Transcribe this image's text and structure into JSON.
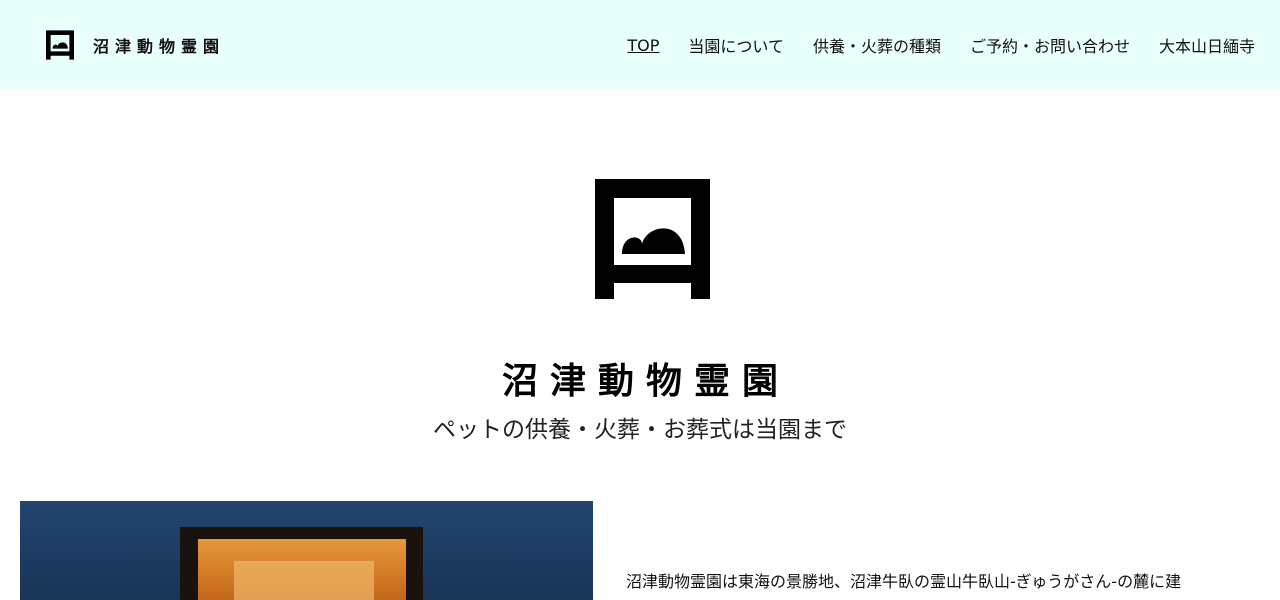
{
  "header": {
    "brand_name": "沼津動物霊園",
    "logo_icon": "mountain-frame-icon",
    "background_color": "#e9fffb"
  },
  "nav": {
    "items": [
      {
        "label": "TOP",
        "active": true
      },
      {
        "label": "当園について",
        "active": false
      },
      {
        "label": "供養・火葬の種類",
        "active": false
      },
      {
        "label": "ご予約・お問い合わせ",
        "active": false
      },
      {
        "label": "大本山日緬寺",
        "active": false
      }
    ]
  },
  "hero": {
    "logo_icon": "mountain-frame-icon",
    "title": "沼津動物霊園",
    "subtitle": "ペットの供養・火葬・お葬式は当園まで"
  },
  "intro": {
    "text": "沼津動物霊園は東海の景勝地、沼津牛臥の霊山牛臥山-ぎゅうがさん-の麓に建"
  }
}
